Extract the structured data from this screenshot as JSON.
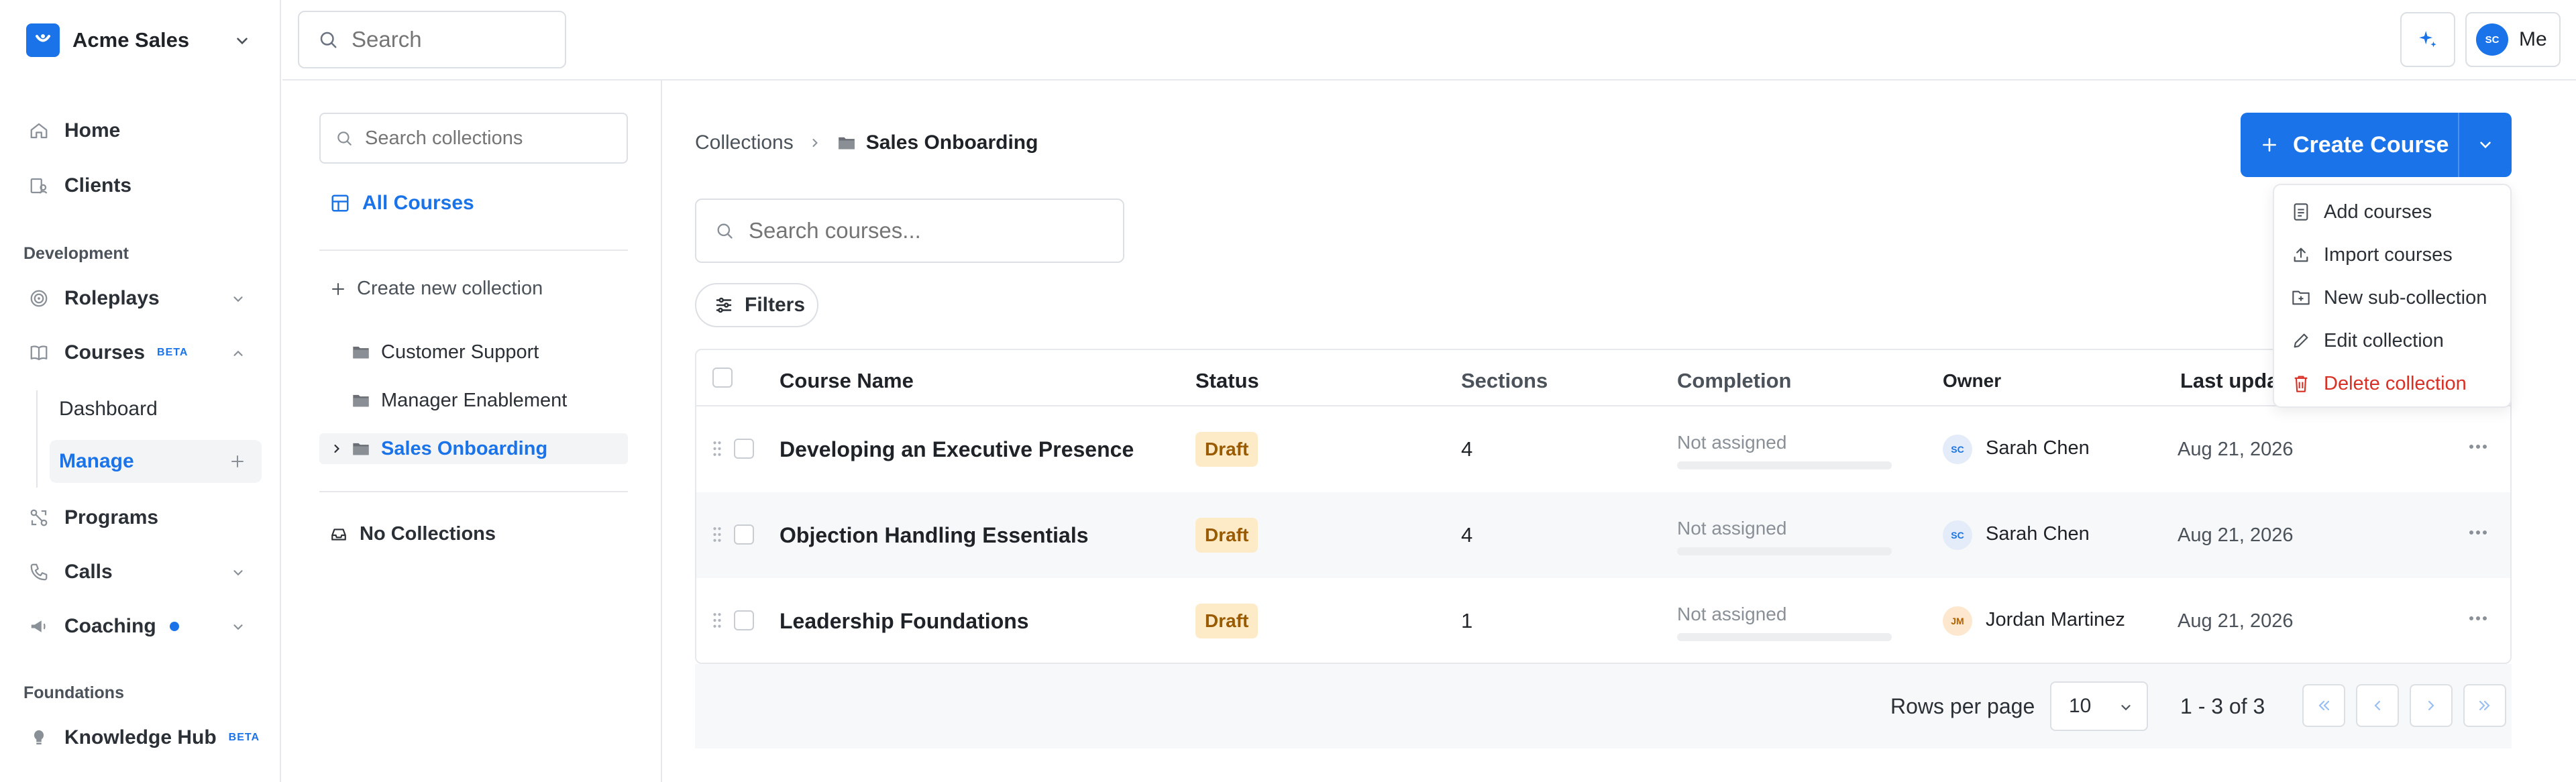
{
  "workspace": {
    "name": "Acme Sales"
  },
  "sidebar": {
    "items": [
      {
        "label": "Home",
        "icon": "home-icon"
      },
      {
        "label": "Clients",
        "icon": "clients-icon"
      }
    ],
    "section_development": "Development",
    "dev_items": [
      {
        "label": "Roleplays",
        "icon": "target-icon"
      },
      {
        "label": "Courses",
        "icon": "book-icon",
        "badge": "BETA"
      }
    ],
    "courses_sub": [
      {
        "label": "Dashboard"
      },
      {
        "label": "Manage"
      }
    ],
    "more_items": [
      {
        "label": "Programs",
        "icon": "programs-icon"
      },
      {
        "label": "Calls",
        "icon": "phone-icon"
      },
      {
        "label": "Coaching",
        "icon": "megaphone-icon"
      }
    ],
    "section_foundations": "Foundations",
    "foundation_items": [
      {
        "label": "Knowledge Hub",
        "icon": "bulb-icon",
        "badge": "BETA"
      }
    ]
  },
  "header": {
    "search_placeholder": "Search",
    "user_initials": "SC",
    "user_label": "Me"
  },
  "collections": {
    "search_placeholder": "Search collections",
    "all_courses": "All Courses",
    "create_new": "Create new collection",
    "items": [
      "Customer Support",
      "Manager Enablement",
      "Sales Onboarding"
    ],
    "no_collections": "No Collections"
  },
  "main": {
    "breadcrumb": [
      "Collections",
      "Sales Onboarding"
    ],
    "create_button": "Create Course",
    "search_placeholder": "Search courses...",
    "filters": "Filters",
    "columns": [
      "Course Name",
      "Status",
      "Sections",
      "Completion",
      "Owner",
      "Last upda"
    ],
    "rows": [
      {
        "name": "Developing an Executive Presence",
        "status": "Draft",
        "sections": "4",
        "completion": "Not assigned",
        "owner_initials": "SC",
        "owner": "Sarah Chen",
        "updated": "Aug 21, 2026"
      },
      {
        "name": "Objection Handling Essentials",
        "status": "Draft",
        "sections": "4",
        "completion": "Not assigned",
        "owner_initials": "SC",
        "owner": "Sarah Chen",
        "updated": "Aug 21, 2026"
      },
      {
        "name": "Leadership Foundations",
        "status": "Draft",
        "sections": "1",
        "completion": "Not assigned",
        "owner_initials": "JM",
        "owner": "Jordan Martinez",
        "updated": "Aug 21, 2026"
      }
    ],
    "rows_per_page_label": "Rows per page",
    "rows_per_page": "10",
    "range": "1 - 3 of 3"
  },
  "menu": {
    "items": [
      {
        "label": "Add courses",
        "icon": "add-file-icon"
      },
      {
        "label": "Import courses",
        "icon": "upload-icon"
      },
      {
        "label": "New sub-collection",
        "icon": "folder-plus-icon"
      },
      {
        "label": "Edit collection",
        "icon": "pencil-icon"
      },
      {
        "label": "Delete collection",
        "icon": "trash-icon",
        "danger": true
      }
    ]
  },
  "colors": {
    "accent": "#1a73e8",
    "danger": "#d93025",
    "draft_bg": "#fdebc8",
    "draft_text": "#9a5b00"
  }
}
